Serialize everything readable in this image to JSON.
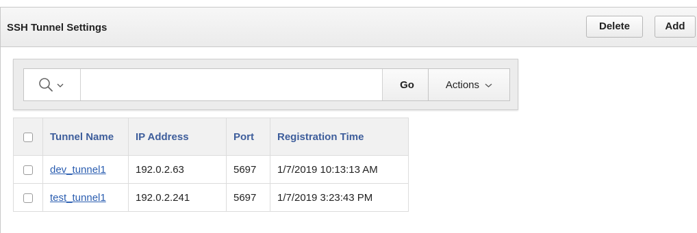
{
  "region": {
    "title": "SSH Tunnel Settings",
    "delete_label": "Delete",
    "add_label": "Add"
  },
  "toolbar": {
    "search_value": "",
    "go_label": "Go",
    "actions_label": "Actions"
  },
  "table": {
    "columns": [
      "Tunnel Name",
      "IP Address",
      "Port",
      "Registration Time"
    ],
    "rows": [
      {
        "tunnel_name": "dev_tunnel1",
        "ip_address": "192.0.2.63",
        "port": "5697",
        "registration_time": "1/7/2019 10:13:13 AM"
      },
      {
        "tunnel_name": "test_tunnel1",
        "ip_address": "192.0.2.241",
        "port": "5697",
        "registration_time": "1/7/2019 3:23:43 PM"
      }
    ]
  },
  "icons": {
    "search": "search-icon",
    "search_menu_chevron": "chevron-down-icon",
    "actions_chevron": "chevron-down-icon"
  },
  "colors": {
    "header_link": "#3d5d9b",
    "row_link": "#2a5db0"
  }
}
